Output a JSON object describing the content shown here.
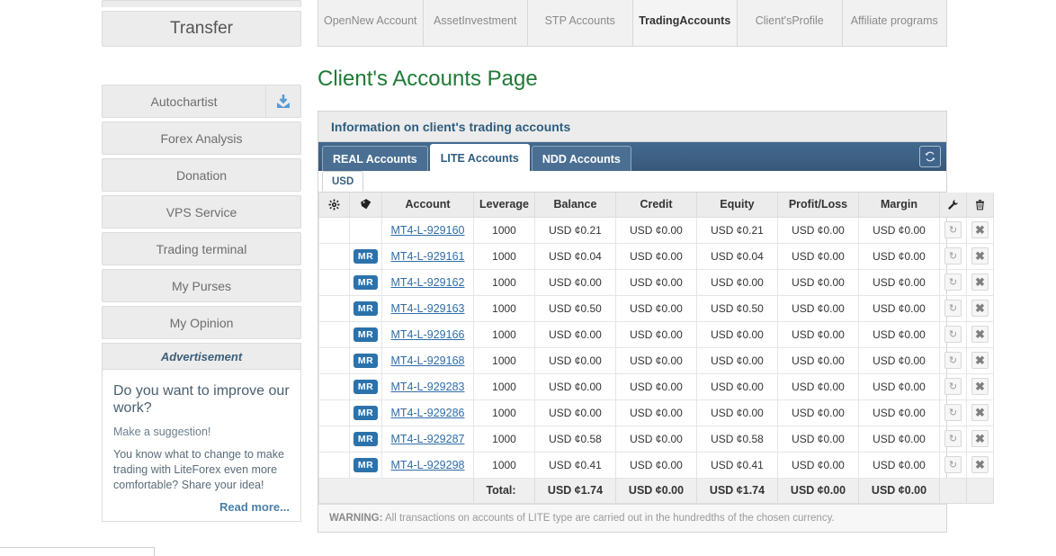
{
  "top_nav": {
    "items": [
      {
        "label": "Open\nNew Account",
        "line1": "Open",
        "line2": "New Account",
        "active": false
      },
      {
        "label": "Asset Investment",
        "line1": "Asset",
        "line2": "Investment",
        "active": false
      },
      {
        "label": "STP Accounts",
        "line1": "STP Accounts",
        "line2": "",
        "active": false
      },
      {
        "label": "Trading Accounts",
        "line1": "Trading",
        "line2": "Accounts",
        "active": true
      },
      {
        "label": "Client's Profile",
        "line1": "Client's",
        "line2": "Profile",
        "active": false
      },
      {
        "label": "Affiliate programs",
        "line1": "Affiliate programs",
        "line2": "",
        "active": false
      }
    ]
  },
  "sidebar": {
    "transfer_label": "Transfer",
    "items": [
      {
        "label": "Autochartist",
        "icon": "download-icon"
      },
      {
        "label": "Forex Analysis"
      },
      {
        "label": "Donation"
      },
      {
        "label": "VPS Service"
      },
      {
        "label": "Trading terminal"
      },
      {
        "label": "My Purses"
      },
      {
        "label": "My Opinion"
      }
    ],
    "advertisement": {
      "header": "Advertisement",
      "title": "Do you want to improve our work?",
      "subtitle": "Make a suggestion!",
      "body": "You know what to change to make trading with LiteForex even more comfortable? Share your idea!",
      "read_more": "Read more..."
    }
  },
  "main": {
    "page_title": "Client's Accounts Page",
    "panel_header": "Information on client's trading accounts",
    "refresh_icon": "refresh-icon",
    "tabs": [
      {
        "label": "REAL Accounts",
        "active": false
      },
      {
        "label": "LITE Accounts",
        "active": true
      },
      {
        "label": "NDD Accounts",
        "active": false
      }
    ],
    "currency_tabs": [
      {
        "label": "USD",
        "active": true
      }
    ],
    "table": {
      "headers": {
        "gear": "gear-icon",
        "tag": "tag-icon",
        "account": "Account",
        "leverage": "Leverage",
        "balance": "Balance",
        "credit": "Credit",
        "equity": "Equity",
        "profit_loss": "Profit/Loss",
        "margin": "Margin",
        "wrench": "wrench-icon",
        "trash": "trash-icon"
      },
      "rows": [
        {
          "badge": "",
          "account": "MT4-L-929160",
          "leverage": "1000",
          "balance": "USD ¢0.21",
          "credit": "USD ¢0.00",
          "equity": "USD ¢0.21",
          "profit_loss": "USD ¢0.00",
          "margin": "USD ¢0.00"
        },
        {
          "badge": "MR",
          "account": "MT4-L-929161",
          "leverage": "1000",
          "balance": "USD ¢0.04",
          "credit": "USD ¢0.00",
          "equity": "USD ¢0.04",
          "profit_loss": "USD ¢0.00",
          "margin": "USD ¢0.00"
        },
        {
          "badge": "MR",
          "account": "MT4-L-929162",
          "leverage": "1000",
          "balance": "USD ¢0.00",
          "credit": "USD ¢0.00",
          "equity": "USD ¢0.00",
          "profit_loss": "USD ¢0.00",
          "margin": "USD ¢0.00"
        },
        {
          "badge": "MR",
          "account": "MT4-L-929163",
          "leverage": "1000",
          "balance": "USD ¢0.50",
          "credit": "USD ¢0.00",
          "equity": "USD ¢0.50",
          "profit_loss": "USD ¢0.00",
          "margin": "USD ¢0.00"
        },
        {
          "badge": "MR",
          "account": "MT4-L-929166",
          "leverage": "1000",
          "balance": "USD ¢0.00",
          "credit": "USD ¢0.00",
          "equity": "USD ¢0.00",
          "profit_loss": "USD ¢0.00",
          "margin": "USD ¢0.00"
        },
        {
          "badge": "MR",
          "account": "MT4-L-929168",
          "leverage": "1000",
          "balance": "USD ¢0.00",
          "credit": "USD ¢0.00",
          "equity": "USD ¢0.00",
          "profit_loss": "USD ¢0.00",
          "margin": "USD ¢0.00"
        },
        {
          "badge": "MR",
          "account": "MT4-L-929283",
          "leverage": "1000",
          "balance": "USD ¢0.00",
          "credit": "USD ¢0.00",
          "equity": "USD ¢0.00",
          "profit_loss": "USD ¢0.00",
          "margin": "USD ¢0.00"
        },
        {
          "badge": "MR",
          "account": "MT4-L-929286",
          "leverage": "1000",
          "balance": "USD ¢0.00",
          "credit": "USD ¢0.00",
          "equity": "USD ¢0.00",
          "profit_loss": "USD ¢0.00",
          "margin": "USD ¢0.00"
        },
        {
          "badge": "MR",
          "account": "MT4-L-929287",
          "leverage": "1000",
          "balance": "USD ¢0.58",
          "credit": "USD ¢0.00",
          "equity": "USD ¢0.58",
          "profit_loss": "USD ¢0.00",
          "margin": "USD ¢0.00"
        },
        {
          "badge": "MR",
          "account": "MT4-L-929298",
          "leverage": "1000",
          "balance": "USD ¢0.41",
          "credit": "USD ¢0.00",
          "equity": "USD ¢0.41",
          "profit_loss": "USD ¢0.00",
          "margin": "USD ¢0.00"
        }
      ],
      "total": {
        "label": "Total:",
        "balance": "USD ¢1.74",
        "credit": "USD ¢0.00",
        "equity": "USD ¢1.74",
        "profit_loss": "USD ¢0.00",
        "margin": "USD ¢0.00"
      },
      "row_actions": {
        "reset_icon": "reset-icon",
        "close_icon": "close-icon"
      }
    },
    "warning": {
      "prefix": "WARNING:",
      "text": " All transactions on accounts of LITE type are carried out in the hundredths of the chosen currency."
    }
  },
  "colors": {
    "title_green": "#1f7a36",
    "tabbar_blue": "#3d6084",
    "badge_blue": "#2b72ab",
    "link_blue": "#2f6da8"
  }
}
